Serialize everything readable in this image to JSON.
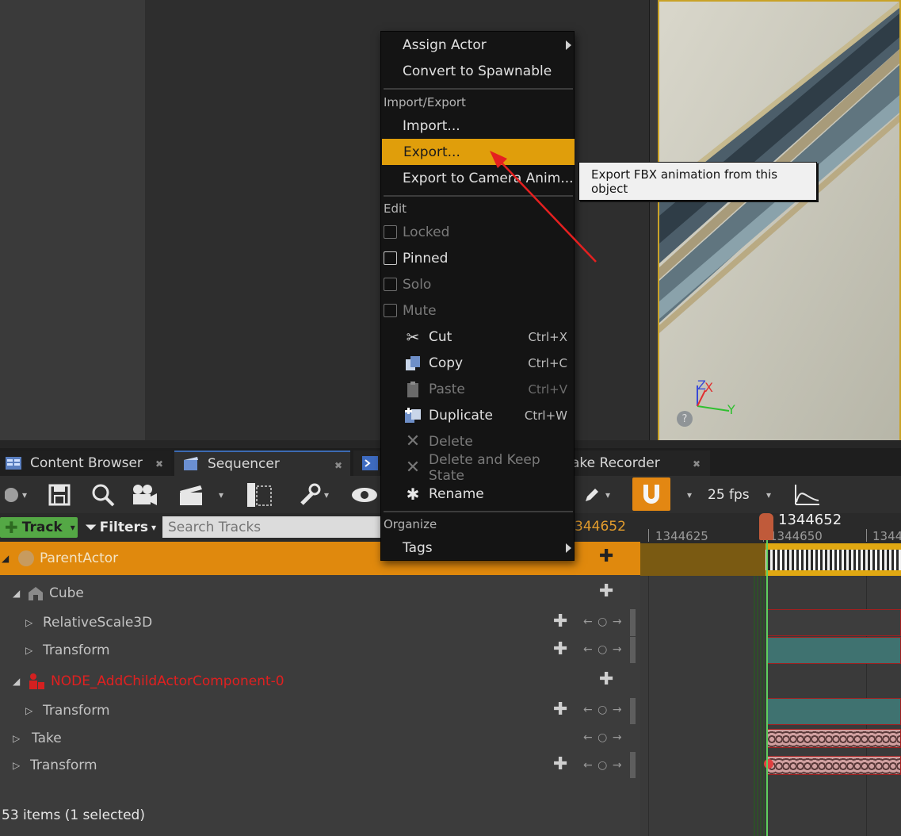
{
  "tabs": [
    {
      "label": "Content Browser"
    },
    {
      "label": "Sequencer"
    },
    {
      "label": "ake Recorder"
    }
  ],
  "toolbar": {
    "fps_label": "25 fps"
  },
  "filter_row": {
    "track_label": "Track",
    "filters_label": "Filters",
    "search_placeholder": "Search Tracks",
    "current_frame_partial": "344652"
  },
  "timeline": {
    "playhead_frame": "1344652",
    "ruler_ticks": [
      "1344625",
      "1344650",
      "1344"
    ],
    "accent_color": "#e09e0b"
  },
  "tracks": [
    {
      "label": "ParentActor",
      "level": 0
    },
    {
      "label": "Cube",
      "level": 1
    },
    {
      "label": "RelativeScale3D",
      "level": 2
    },
    {
      "label": "Transform",
      "level": 2
    },
    {
      "label": "NODE_AddChildActorComponent-0",
      "level": 1,
      "color": "#e02020"
    },
    {
      "label": "Transform",
      "level": 2
    },
    {
      "label": "Take",
      "level": 0
    },
    {
      "label": "Transform",
      "level": 0
    }
  ],
  "status": {
    "items_text": "53 items (1 selected)"
  },
  "context_menu": {
    "assign_actor": "Assign Actor",
    "convert_spawnable": "Convert to Spawnable",
    "section_import_export": "Import/Export",
    "import": "Import...",
    "export": "Export...",
    "export_camera_anim": "Export to Camera Anim...",
    "section_edit": "Edit",
    "locked": "Locked",
    "pinned": "Pinned",
    "solo": "Solo",
    "mute": "Mute",
    "cut": "Cut",
    "cut_shortcut": "Ctrl+X",
    "copy": "Copy",
    "copy_shortcut": "Ctrl+C",
    "paste": "Paste",
    "paste_shortcut": "Ctrl+V",
    "duplicate": "Duplicate",
    "duplicate_shortcut": "Ctrl+W",
    "delete": "Delete",
    "delete_keep_state": "Delete and Keep State",
    "rename": "Rename",
    "section_organize": "Organize",
    "tags": "Tags"
  },
  "tooltip": {
    "text": "Export FBX animation from this object"
  },
  "viewport_axes": {
    "z": "Z",
    "x": "X",
    "y": "Y"
  }
}
